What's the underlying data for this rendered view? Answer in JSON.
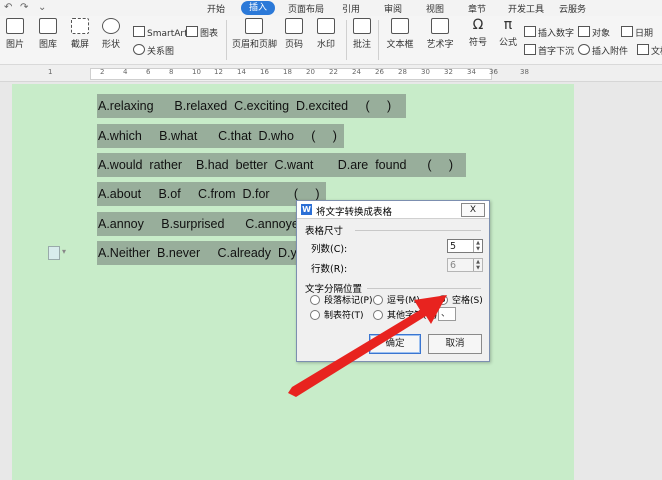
{
  "menu": {
    "quick_icons": [
      "undo-icon",
      "redo-icon",
      "customize-icon"
    ],
    "items": [
      "开始",
      "插入",
      "页面布局",
      "引用",
      "审阅",
      "视图",
      "章节",
      "开发工具",
      "云服务"
    ],
    "active": "插入"
  },
  "ribbon": {
    "picture": "图片",
    "gallery": "图库",
    "screenshot": "截屏",
    "shape": "形状",
    "smartart": "SmartArt",
    "chart": "图表",
    "relation": "关系图",
    "header_footer": "页眉和页脚",
    "page_number": "页码",
    "watermark": "水印",
    "comment": "批注",
    "textbox": "文本框",
    "wordart": "艺术字",
    "symbol": "符号",
    "formula": "公式",
    "insert_number": "插入数字",
    "object": "对象",
    "date": "日期",
    "dropcap": "首字下沉",
    "attachment": "插入附件",
    "document": "文档"
  },
  "ruler": {
    "numbers": [
      "1",
      "2",
      "4",
      "6",
      "8",
      "10",
      "12",
      "14",
      "16",
      "18",
      "20",
      "22",
      "24",
      "26",
      "28",
      "30",
      "32",
      "34",
      "36",
      "38"
    ]
  },
  "document": {
    "lines": [
      "A.relaxing      B.relaxed  C.exciting  D.excited     (     )",
      "A.which     B.what      C.that  D.who     (     )",
      "A.would  rather    B.had  better  C.want       D.are  found      (     )",
      "A.about     B.of     C.from  D.for       (     )",
      "A.annoy     B.surprised      C.annoyed I",
      "A.Neither  B.never     C.already  D.ye"
    ]
  },
  "dialog": {
    "title": "将文字转换成表格",
    "close": "X",
    "table_size": "表格尺寸",
    "columns_label": "列数(C):",
    "columns_value": "5",
    "rows_label": "行数(R):",
    "rows_value": "6",
    "separator_section": "文字分隔位置",
    "options": [
      "段落标记(P)",
      "逗号(M)",
      "空格(S)",
      "制表符(T)",
      "其他字符(O):"
    ],
    "selected_option": "空格(S)",
    "other_value": "、",
    "ok": "确定",
    "cancel": "取消"
  },
  "colors": {
    "page_bg": "#c8ecc9",
    "selection": "#98ae9b",
    "accent": "#2b79d8",
    "arrow": "#e8231f"
  }
}
